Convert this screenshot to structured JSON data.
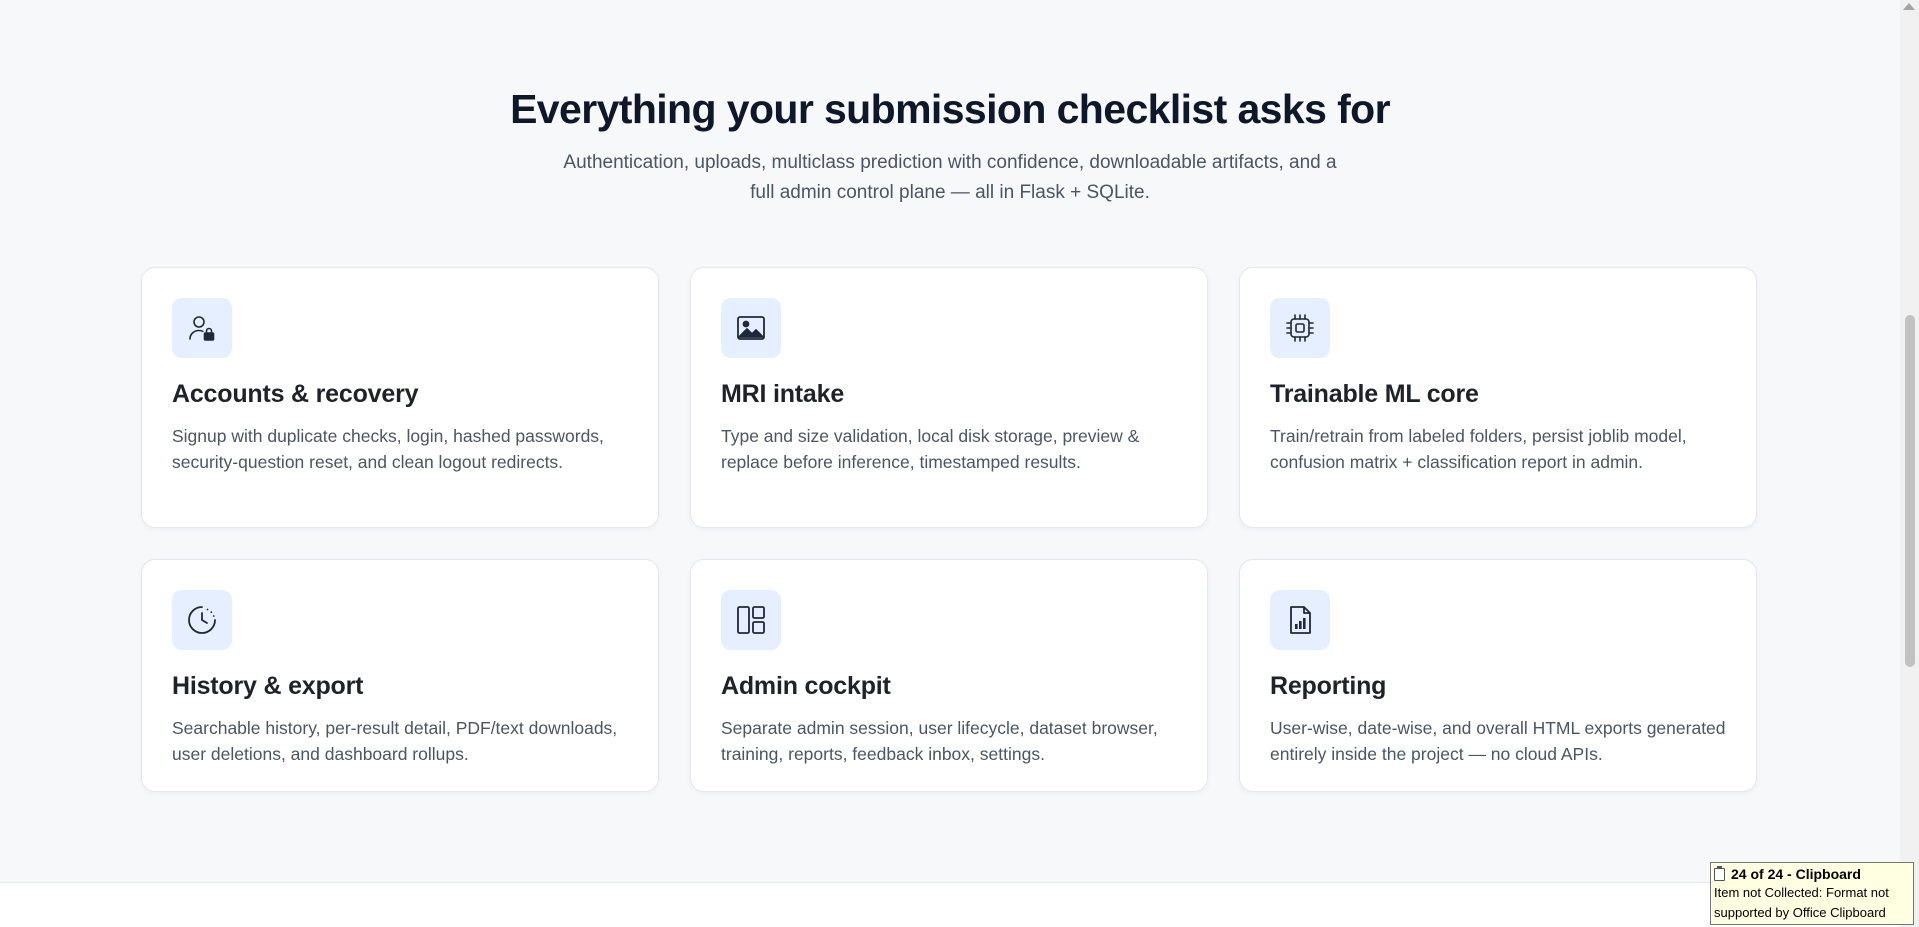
{
  "section": {
    "title": "Everything your submission checklist asks for",
    "subtitle": "Authentication, uploads, multiclass prediction with confidence, downloadable artifacts, and a full admin control plane — all in Flask + SQLite."
  },
  "features": [
    {
      "icon": "user-lock-icon",
      "title": "Accounts & recovery",
      "description": "Signup with duplicate checks, login, hashed passwords, security-question reset, and clean logout redirects."
    },
    {
      "icon": "image-icon",
      "title": "MRI intake",
      "description": "Type and size validation, local disk storage, preview & replace before inference, timestamped results."
    },
    {
      "icon": "cpu-chip-icon",
      "title": "Trainable ML core",
      "description": "Train/retrain from labeled folders, persist joblib model, confusion matrix + classification report in admin."
    },
    {
      "icon": "clock-history-icon",
      "title": "History & export",
      "description": "Searchable history, per-result detail, PDF/text downloads, user deletions, and dashboard rollups."
    },
    {
      "icon": "dashboard-layout-icon",
      "title": "Admin cockpit",
      "description": "Separate admin session, user lifecycle, dataset browser, training, reports, feedback inbox, settings."
    },
    {
      "icon": "report-chart-icon",
      "title": "Reporting",
      "description": "User-wise, date-wise, and overall HTML exports generated entirely inside the project — no cloud APIs."
    }
  ],
  "clipboard": {
    "title": "24 of 24 - Clipboard",
    "message": "Item not Collected: Format not supported by Office Clipboard"
  },
  "colors": {
    "icon_stroke": "#1e293b",
    "icon_bg": "#e6efff",
    "heading": "#0f172a",
    "body_text": "#4b5563"
  }
}
